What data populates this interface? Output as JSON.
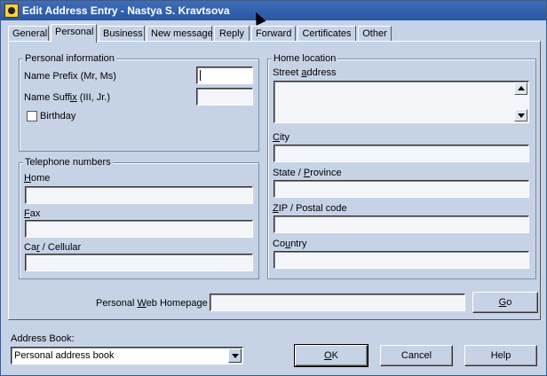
{
  "window": {
    "title": "Edit Address Entry - Nastya S. Kravtsova",
    "icon": "address-book-icon"
  },
  "tabs": [
    {
      "label": "General"
    },
    {
      "label": "Personal",
      "active": true
    },
    {
      "label": "Business"
    },
    {
      "label": "New message"
    },
    {
      "label": "Reply"
    },
    {
      "label": "Forward"
    },
    {
      "label": "Certificates"
    },
    {
      "label": "Other"
    }
  ],
  "personal_info": {
    "legend": "Personal information",
    "prefix_label_pre": "Name Prefix (Mr, Ms)",
    "suffix_label_a": "Name Suff",
    "suffix_label_u": "ix",
    "suffix_label_b": " (III, Jr.)",
    "birthday_label": "Birthday",
    "prefix_value": "",
    "suffix_value": ""
  },
  "telephone": {
    "legend": "Telephone numbers",
    "home_u": "H",
    "home_rest": "ome",
    "fax_u": "F",
    "fax_rest": "ax",
    "car_a": "Ca",
    "car_u": "r",
    "car_b": " / Cellular",
    "home_value": "",
    "fax_value": "",
    "car_value": ""
  },
  "home_location": {
    "legend": "Home location",
    "street_a": "Street ",
    "street_u": "a",
    "street_b": "ddress",
    "city_u": "C",
    "city_rest": "ity",
    "state_a": "State / ",
    "state_u": "P",
    "state_b": "rovince",
    "zip_u": "Z",
    "zip_rest": "IP / Postal code",
    "country_a": "Co",
    "country_u": "u",
    "country_b": "ntry",
    "street_value": "",
    "city_value": "",
    "state_value": "",
    "zip_value": "",
    "country_value": ""
  },
  "homepage": {
    "label_a": "Personal ",
    "label_u": "W",
    "label_b": "eb Homepage",
    "value": "",
    "go_u": "G",
    "go_rest": "o"
  },
  "footer": {
    "address_book_label": "Address Book:",
    "address_book_value": "Personal address book",
    "ok_u": "O",
    "ok_rest": "K",
    "cancel_label": "Cancel",
    "help_label": "Help"
  }
}
